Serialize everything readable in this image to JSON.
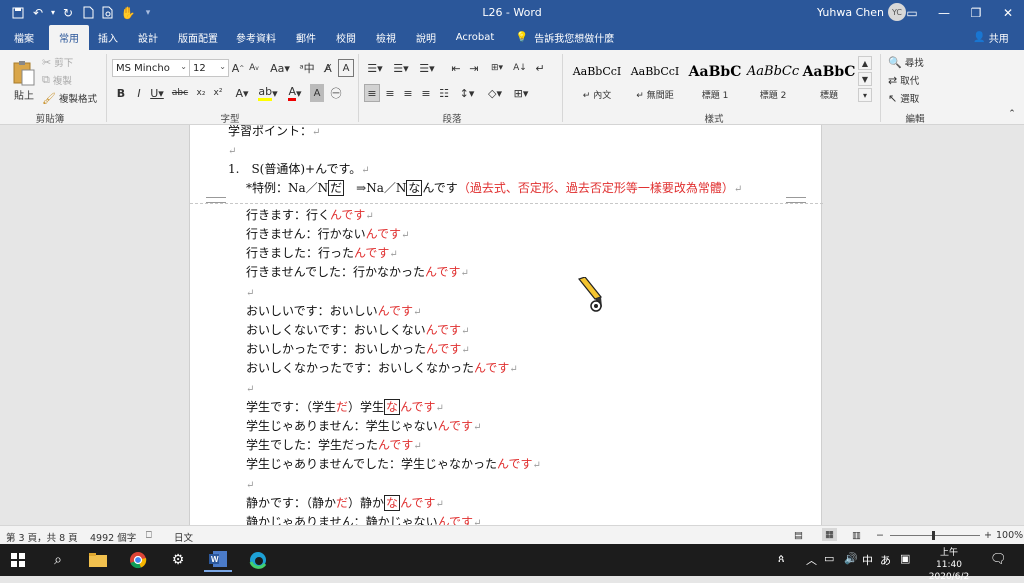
{
  "app": {
    "doc_title": "L26  -  Word",
    "user_name": "Yuhwa Chen",
    "user_initials": "YC"
  },
  "quick_access": [
    "save-icon",
    "undo-icon",
    "redo-icon",
    "customize-icon",
    "new-doc-icon",
    "print-preview-icon",
    "touch-mode-icon",
    "more-icon"
  ],
  "window_controls": {
    "ribbon_opts": "▭",
    "minimize": "—",
    "restore": "❐",
    "close": "✕"
  },
  "tabs": [
    "檔案",
    "常用",
    "插入",
    "設計",
    "版面配置",
    "參考資料",
    "郵件",
    "校閱",
    "檢視",
    "說明",
    "Acrobat"
  ],
  "tell_me": "告訴我您想做什麼",
  "share": "共用",
  "ribbon": {
    "clipboard": {
      "paste": "貼上",
      "cut": "剪下",
      "copy": "複製",
      "format_painter": "複製格式",
      "label": "剪貼簿"
    },
    "font": {
      "name": "MS Mincho",
      "size": "12",
      "label": "字型"
    },
    "paragraph": {
      "label": "段落"
    },
    "styles": {
      "label": "樣式",
      "items": [
        {
          "sample": "AaBbCcI",
          "name": "↵ 內文"
        },
        {
          "sample": "AaBbCcI",
          "name": "↵ 無間距"
        },
        {
          "sample": "AaBbC",
          "name": "標題 1"
        },
        {
          "sample": "AaBbCc",
          "name": "標題 2"
        },
        {
          "sample": "AaBbC",
          "name": "標題"
        }
      ]
    },
    "editing": {
      "find": "尋找",
      "replace": "取代",
      "select": "選取",
      "label": "編輯"
    }
  },
  "document": {
    "lines": [
      {
        "parts": [
          {
            "t": "学習ポイント：",
            "c": "n"
          },
          {
            "t": "↵",
            "c": "p"
          }
        ]
      },
      {
        "parts": [
          {
            "t": "↵",
            "c": "p"
          }
        ]
      },
      {
        "parts": [
          {
            "t": "1.　S(普通体)+んです。",
            "c": "n"
          },
          {
            "t": "↵",
            "c": "p"
          }
        ]
      },
      {
        "parts": [
          {
            "t": "*特例：Na／N",
            "c": "n"
          },
          {
            "t": "だ",
            "c": "box"
          },
          {
            "t": "　⇒Na／N",
            "c": "n"
          },
          {
            "t": "な",
            "c": "box"
          },
          {
            "t": "んです",
            "c": "n"
          },
          {
            "t": "（過去式、否定形、過去否定形等一樣要改為常體）",
            "c": "r"
          },
          {
            "t": "↵",
            "c": "p"
          }
        ]
      },
      {
        "parts": [
          {
            "t": "行きます：行く",
            "c": "n"
          },
          {
            "t": "んです",
            "c": "r"
          },
          {
            "t": "↵",
            "c": "p"
          }
        ]
      },
      {
        "parts": [
          {
            "t": "行きません：行かない",
            "c": "n"
          },
          {
            "t": "んです",
            "c": "r"
          },
          {
            "t": "↵",
            "c": "p"
          }
        ]
      },
      {
        "parts": [
          {
            "t": "行きました：行った",
            "c": "n"
          },
          {
            "t": "んです",
            "c": "r"
          },
          {
            "t": "↵",
            "c": "p"
          }
        ]
      },
      {
        "parts": [
          {
            "t": "行きませんでした：行かなかった",
            "c": "n"
          },
          {
            "t": "んです",
            "c": "r"
          },
          {
            "t": "↵",
            "c": "p"
          }
        ]
      },
      {
        "parts": [
          {
            "t": "↵",
            "c": "p"
          }
        ]
      },
      {
        "parts": [
          {
            "t": "おいしいです：おいしい",
            "c": "n"
          },
          {
            "t": "んです",
            "c": "r"
          },
          {
            "t": "↵",
            "c": "p"
          }
        ]
      },
      {
        "parts": [
          {
            "t": "おいしくないです：おいしくない",
            "c": "n"
          },
          {
            "t": "んです",
            "c": "r"
          },
          {
            "t": "↵",
            "c": "p"
          }
        ]
      },
      {
        "parts": [
          {
            "t": "おいしかったです：おいしかった",
            "c": "n"
          },
          {
            "t": "んです",
            "c": "r"
          },
          {
            "t": "↵",
            "c": "p"
          }
        ]
      },
      {
        "parts": [
          {
            "t": "おいしくなかったです：おいしくなかった",
            "c": "n"
          },
          {
            "t": "んです",
            "c": "r"
          },
          {
            "t": "↵",
            "c": "p"
          }
        ]
      },
      {
        "parts": [
          {
            "t": "↵",
            "c": "p"
          }
        ]
      },
      {
        "parts": [
          {
            "t": "学生です：（学生",
            "c": "n"
          },
          {
            "t": "だ",
            "c": "r"
          },
          {
            "t": "）学生",
            "c": "n"
          },
          {
            "t": "な",
            "c": "rbox"
          },
          {
            "t": "んです",
            "c": "r"
          },
          {
            "t": "↵",
            "c": "p"
          }
        ]
      },
      {
        "parts": [
          {
            "t": "学生じゃありません：学生じゃない",
            "c": "n"
          },
          {
            "t": "んです",
            "c": "r"
          },
          {
            "t": "↵",
            "c": "p"
          }
        ]
      },
      {
        "parts": [
          {
            "t": "学生でした：学生だった",
            "c": "n"
          },
          {
            "t": "んです",
            "c": "r"
          },
          {
            "t": "↵",
            "c": "p"
          }
        ]
      },
      {
        "parts": [
          {
            "t": "学生じゃありませんでした：学生じゃなかった",
            "c": "n"
          },
          {
            "t": "んです",
            "c": "r"
          },
          {
            "t": "↵",
            "c": "p"
          }
        ]
      },
      {
        "parts": [
          {
            "t": "↵",
            "c": "p"
          }
        ]
      },
      {
        "parts": [
          {
            "t": "静かです：（静か",
            "c": "n"
          },
          {
            "t": "だ",
            "c": "r"
          },
          {
            "t": "）静か",
            "c": "n"
          },
          {
            "t": "な",
            "c": "rbox"
          },
          {
            "t": "んです",
            "c": "r"
          },
          {
            "t": "↵",
            "c": "p"
          }
        ]
      },
      {
        "parts": [
          {
            "t": "静かじゃありません：静かじゃない",
            "c": "n"
          },
          {
            "t": "んです",
            "c": "r"
          },
          {
            "t": "↵",
            "c": "p"
          }
        ]
      }
    ]
  },
  "status": {
    "page": "第 3 頁，共 8 頁",
    "words": "4992 個字",
    "lang": "日文",
    "zoom": "100%"
  },
  "taskbar": {
    "time": "上午 11:40",
    "date": "2020/6/2",
    "ime": "あ"
  },
  "colors": {
    "word_blue": "#2b579a",
    "red_text": "#e03030"
  }
}
